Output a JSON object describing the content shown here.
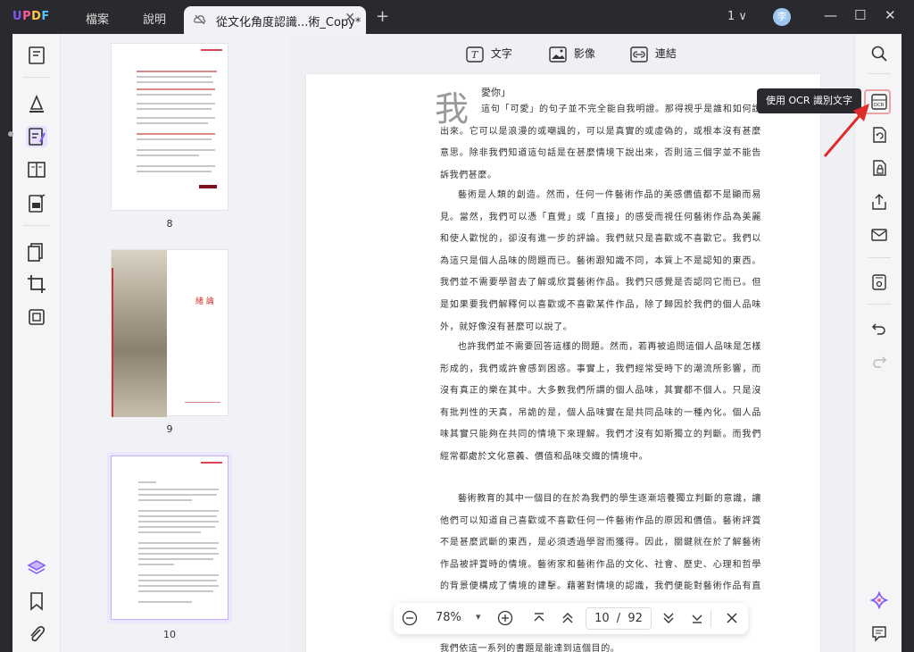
{
  "app": {
    "logo": "UPDF"
  },
  "menu": {
    "file": "檔案",
    "help": "說明"
  },
  "tab": {
    "title": "從文化角度認識...術_Copy*",
    "close": "✕",
    "new": "+"
  },
  "window": {
    "page_indicator": "1 ∨",
    "avatar": "李",
    "minimize": "—",
    "maximize": "☐",
    "close": "✕"
  },
  "edit_toolbar": {
    "text": "文字",
    "image": "影像",
    "link": "連結"
  },
  "thumbnails": [
    {
      "page": "8"
    },
    {
      "page": "9",
      "heading": "緒 論"
    },
    {
      "page": "10"
    }
  ],
  "document": {
    "dropcap": "我",
    "first_line": "愛你」",
    "paragraphs": [
      "這句「可愛」的句子並不完全能自我明證。那得視乎是誰和如何說出來。它可以是浪漫的或嘲諷的，可以是真實的或虛偽的，或根本沒有甚麼意思。除非我們知道這句話是在甚麼情境下說出來，否則這三個字並不能告訴我們甚麼。",
      "藝術是人類的創造。然而，任何一件藝術作品的美感價值都不是顯而易見。當然，我們可以憑「直覺」或「直接」的感受而視任何藝術作品為美麗和使人歡悅的，卻沒有進一步的評論。我們就只是喜歡或不喜歡它。我們以為這只是個人品味的問題而已。藝術跟知識不同，本質上不是認知的東西。我們並不需要學習去了解或欣賞藝術作品。我們只感覺是否認同它而已。但是如果要我們解釋何以喜歡或不喜歡某件作品，除了歸因於我們的個人品味外，就好像沒有甚麼可以說了。",
      "也許我們並不需要回答這樣的問題。然而，若再被追問這個人品味是怎樣形成的，我們或許會感到困惑。事實上，我們經常受時下的潮流所影響，而沒有真正的樂在其中。大多數我們所謂的個人品味，其實都不個人。只是沒有批判性的天真，吊詭的是，個人品味實在是共同品味的一種內化。個人品味其實只能夠在共同的情境下來理解。我們才沒有如斯獨立的判斷。而我們經常都處於文化意義、價值和品味交織的情境中。",
      "藝術教育的其中一個目的在於為我們的學生逐漸培養獨立判斷的意識，讓他們可以知道自己喜歡或不喜歡任何一件藝術作品的原因和價值。藝術評賞不是甚麼武斷的東西，是必須透過學習而獲得。因此，關鍵就在於了解藝術作品被評賞時的情境。藝術家和藝術作品的文化、社會、歷史、心理和哲學的背景便構成了情境的建擊。藉著對情境的認識，我們便能對藝術作品有直接的接觸，然後能告訴自己為何喜歡",
      "我們依這一系列的書題是能達到這個目的。"
    ]
  },
  "navbar": {
    "zoom_out": "−",
    "zoom": "78%",
    "zoom_dropdown": "▾",
    "zoom_in": "+",
    "current_page": "10",
    "page_sep": "/",
    "total_pages": "92"
  },
  "tooltip": {
    "text": "使用 OCR 識別文字"
  },
  "colors": {
    "accent": "#7f5af0",
    "arrow": "#e02b2b",
    "dark_bg": "#2a2a2e"
  }
}
